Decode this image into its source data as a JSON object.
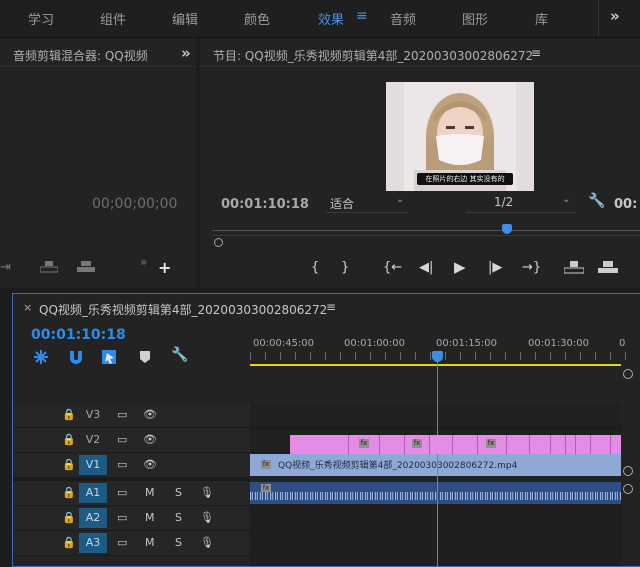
{
  "workspaces": {
    "items": [
      "学习",
      "组件",
      "编辑",
      "颜色",
      "效果",
      "音频",
      "图形",
      "库"
    ],
    "active_index": 4,
    "more_icon": "double-chevron-right"
  },
  "audio_mixer": {
    "title": "音频剪辑混合器: QQ视频",
    "timecode": "00;00;00;00"
  },
  "program_monitor": {
    "title": "节目: QQ视频_乐秀视频剪辑第4部_20200303002806272",
    "timecode": "00:01:10:18",
    "fit_label": "适合",
    "resolution_label": "1/2",
    "right_timecode_partial": "00:",
    "caption": "在照片的右边 其实没有的"
  },
  "timeline": {
    "tab_title": "QQ视频_乐秀视频剪辑第4部_20200303002806272",
    "timecode": "00:01:10:18",
    "ruler": [
      "00:00:45:00",
      "00:01:00:00",
      "00:01:15:00",
      "00:01:30:00",
      "0"
    ],
    "tracks": {
      "v3": "V3",
      "v2": "V2",
      "v1": "V1",
      "a1": "A1",
      "a2": "A2",
      "a3": "A3",
      "m": "M",
      "s": "S"
    },
    "v1_clip_label": "QQ视频_乐秀视频剪辑第4部_20200303002806272.mp4",
    "fx_label": "fx"
  },
  "colors": {
    "accent_blue": "#2d8ceb",
    "active_workspace": "#4a8fe7",
    "v2_clip": "#e48ce6",
    "v1_clip": "#8fa9d6",
    "audio_clip": "#2f4e86",
    "playhead": "#3d8fe8",
    "work_area": "#e8d800"
  }
}
